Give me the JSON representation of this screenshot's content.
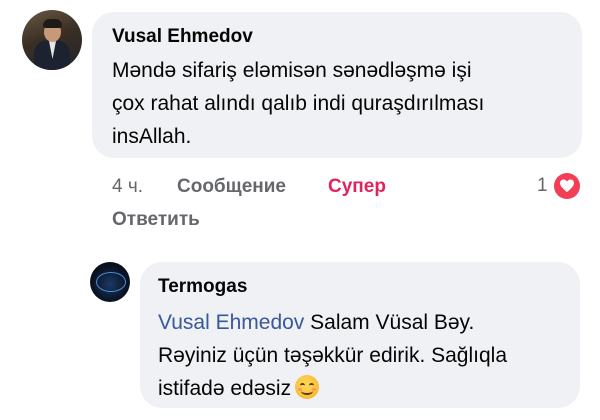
{
  "comment": {
    "author": "Vusal Ehmedov",
    "lines": [
      "Məndə sifariş eləmisən sənədləşmə işi",
      "çox rahat alındı qalıb indi quraşdırılması",
      "insAllah."
    ],
    "time": "4 ч.",
    "actions": {
      "message": "Сообщение",
      "super": "Супер",
      "reply": "Ответить"
    },
    "reaction_count": "1",
    "reaction_icon": "heart-icon"
  },
  "reply": {
    "author": "Termogas",
    "mention": "Vusal Ehmedov",
    "line1_rest": " Salam Vüsal Bəy.",
    "line2": "Rəyiniz üçün təşəkkür edirik. Sağlıqla",
    "line3": "istifadə edəsiz",
    "emoji": "smiling-face-icon"
  },
  "colors": {
    "bubble": "#eff1f4",
    "mention": "#385898",
    "super": "#e0245e",
    "heart": "#f33e58",
    "muted": "#65676b"
  }
}
